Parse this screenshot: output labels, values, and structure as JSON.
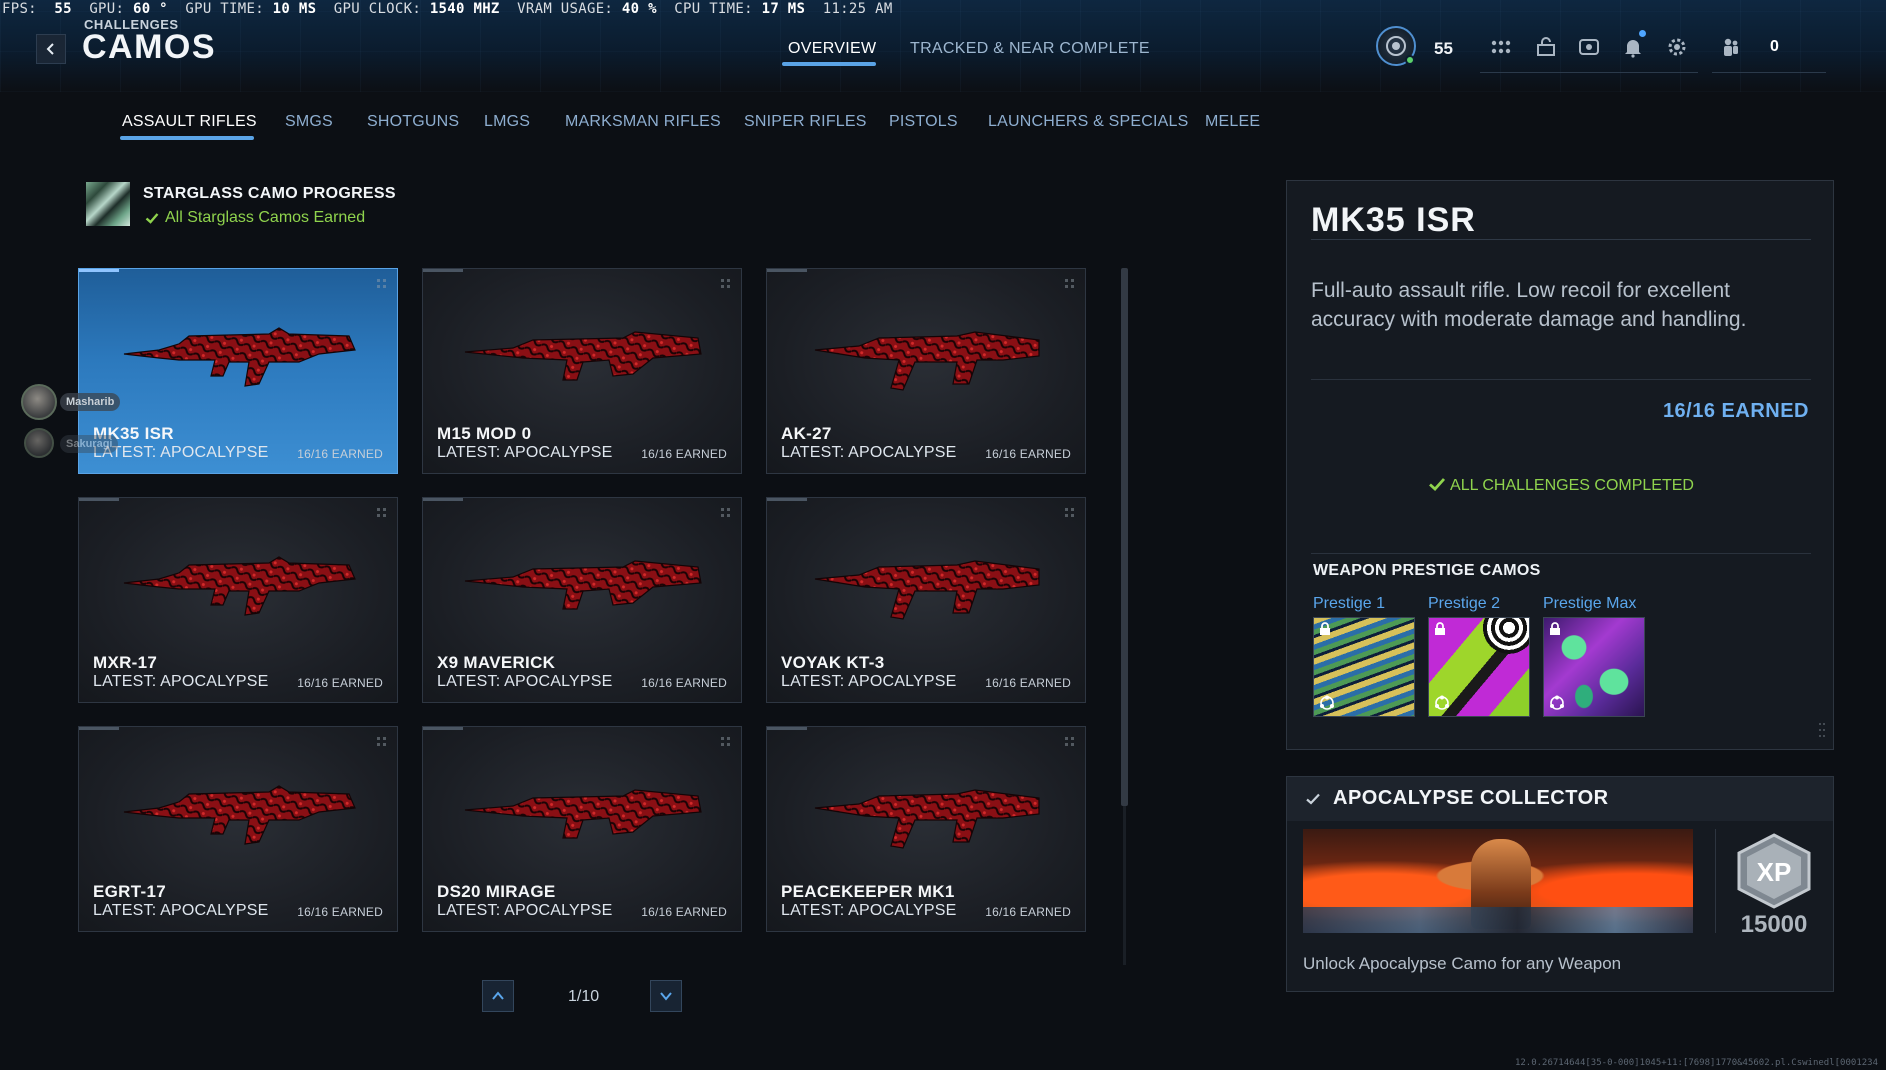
{
  "perf_overlay": {
    "fps_label": "FPS:",
    "fps": "55",
    "gpu_label": "GPU:",
    "gpu": "60 °",
    "gpu_time_label": "GPU TIME:",
    "gpu_time": "10 MS",
    "gpu_clock_label": "GPU CLOCK:",
    "gpu_clock": "1540 MHZ",
    "vram_label": "VRAM USAGE:",
    "vram": "40 %",
    "cpu_time_label": "CPU TIME:",
    "cpu_time": "17 MS",
    "clock": "11:25 AM"
  },
  "header": {
    "breadcrumb": "CHALLENGES",
    "title": "CAMOS",
    "tabs": [
      {
        "label": "OVERVIEW",
        "active": true
      },
      {
        "label": "TRACKED & NEAR COMPLETE",
        "active": false
      }
    ],
    "player_level": "55",
    "party_count": "0",
    "icons": [
      "rank-badge-icon",
      "apps-grid-icon",
      "store-icon",
      "social-icon",
      "notifications-bell-icon",
      "settings-gear-icon",
      "party-icon"
    ],
    "accent_color": "#5aa3e6"
  },
  "categories": [
    {
      "label": "ASSAULT RIFLES",
      "active": true
    },
    {
      "label": "SMGS"
    },
    {
      "label": "SHOTGUNS"
    },
    {
      "label": "LMGS"
    },
    {
      "label": "MARKSMAN RIFLES"
    },
    {
      "label": "SNIPER RIFLES"
    },
    {
      "label": "PISTOLS"
    },
    {
      "label": "LAUNCHERS & SPECIALS"
    },
    {
      "label": "MELEE"
    }
  ],
  "starglass": {
    "title": "STARGLASS CAMO PROGRESS",
    "status": "All Starglass Camos Earned",
    "status_color": "#8fd34d"
  },
  "weapons": [
    {
      "name": "MK35 ISR",
      "latest": "LATEST: APOCALYPSE",
      "earned": "16/16 EARNED",
      "selected": true
    },
    {
      "name": "M15 MOD 0",
      "latest": "LATEST: APOCALYPSE",
      "earned": "16/16 EARNED"
    },
    {
      "name": "AK-27",
      "latest": "LATEST: APOCALYPSE",
      "earned": "16/16 EARNED"
    },
    {
      "name": "MXR-17",
      "latest": "LATEST: APOCALYPSE",
      "earned": "16/16 EARNED"
    },
    {
      "name": "X9 MAVERICK",
      "latest": "LATEST: APOCALYPSE",
      "earned": "16/16 EARNED"
    },
    {
      "name": "VOYAK KT-3",
      "latest": "LATEST: APOCALYPSE",
      "earned": "16/16 EARNED"
    },
    {
      "name": "EGRT-17",
      "latest": "LATEST: APOCALYPSE",
      "earned": "16/16 EARNED"
    },
    {
      "name": "DS20 MIRAGE",
      "latest": "LATEST: APOCALYPSE",
      "earned": "16/16 EARNED"
    },
    {
      "name": "PEACEKEEPER MK1",
      "latest": "LATEST: APOCALYPSE",
      "earned": "16/16 EARNED"
    }
  ],
  "pagination": {
    "label": "1/10"
  },
  "friends": [
    {
      "name": "Masharib"
    },
    {
      "name": "Sakuragi"
    }
  ],
  "detail": {
    "weapon_name": "MK35 ISR",
    "description": "Full-auto assault rifle. Low recoil for excellent accuracy with moderate damage and handling.",
    "earned": "16/16 EARNED",
    "all_complete": "ALL CHALLENGES COMPLETED",
    "prestige_heading": "WEAPON PRESTIGE CAMOS",
    "prestige": [
      {
        "label": "Prestige 1"
      },
      {
        "label": "Prestige 2"
      },
      {
        "label": "Prestige Max"
      }
    ]
  },
  "challenge": {
    "title": "APOCALYPSE COLLECTOR",
    "xp_label": "XP",
    "xp": "15000",
    "description": "Unlock Apocalypse Camo for any Weapon"
  },
  "build_info": "12.0.26714644[35-0-000]1045+11:[7698]1770&45602.pl.Cswinedl[0001234"
}
